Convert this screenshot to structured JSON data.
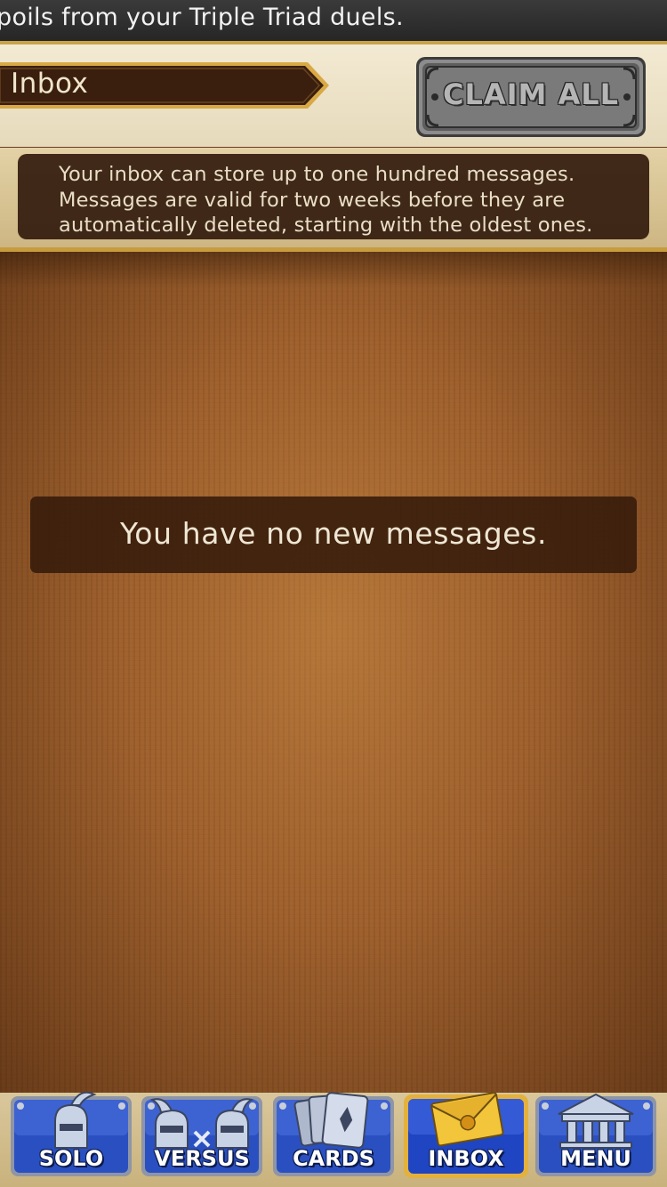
{
  "ticker": {
    "text": "poils from your Triple Triad duels."
  },
  "header": {
    "title": "Inbox",
    "claim_all_label": "CLAIM ALL"
  },
  "info_note": {
    "lines": [
      "Your inbox can store up to one hundred messages.",
      "Messages are valid for two weeks before they are",
      "automatically deleted, starting with the oldest ones."
    ]
  },
  "messages": {
    "empty_text": "You have no new messages."
  },
  "nav": {
    "items": [
      {
        "label": "SOLO",
        "icon": "knight-icon",
        "active": false
      },
      {
        "label": "VERSUS",
        "icon": "two-knights-icon",
        "active": false
      },
      {
        "label": "CARDS",
        "icon": "cards-icon",
        "active": false
      },
      {
        "label": "INBOX",
        "icon": "envelope-icon",
        "active": true
      },
      {
        "label": "MENU",
        "icon": "temple-icon",
        "active": false
      }
    ]
  },
  "colors": {
    "nav_blue": "#2a4fc0",
    "gold_border": "#d8a93c",
    "wood": "#9c5d2a",
    "note_bg": "#341c0e"
  }
}
